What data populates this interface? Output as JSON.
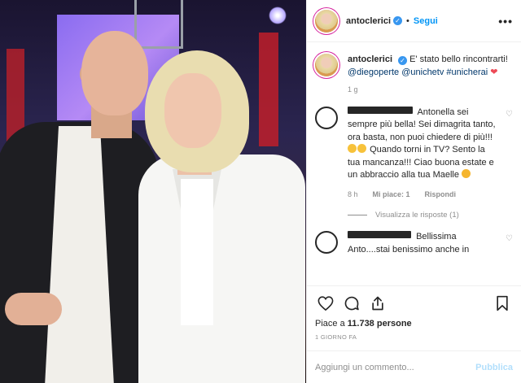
{
  "header": {
    "username": "antoclerici",
    "separator": "•",
    "follow_label": "Segui",
    "more_label": "•••"
  },
  "caption": {
    "username": "antoclerici",
    "text": "E' stato bello rincontrarti!",
    "mention1": "@diegoperte",
    "mention2": "@unichetv",
    "hashtag": "#unicherai",
    "heart": "❤",
    "age": "1 g"
  },
  "comments": [
    {
      "text": "Antonella sei sempre più bella! Sei dimagrita tanto, ora basta, non puoi chiedere di più!!!",
      "text2": "Quando torni in TV? Sento la tua mancanza!!! Ciao buona estate e un abbraccio alla tua Maelle",
      "age": "8 h",
      "likes_label": "Mi piace: 1",
      "reply_label": "Rispondi",
      "view_replies": "Visualizza le risposte (1)"
    },
    {
      "text": "Bellissima Anto....stai benissimo anche in"
    }
  ],
  "actions": {
    "likes_prefix": "Piace a",
    "likes_count": "11.738",
    "likes_suffix": "persone",
    "posted": "1 GIORNO FA"
  },
  "add_comment": {
    "placeholder": "Aggiungi un commento...",
    "publish_label": "Pubblica"
  },
  "colors": {
    "verified": "#3897f0",
    "follow": "#0095f6",
    "publish_disabled": "#b2dffc",
    "heart": "#ed4956"
  }
}
